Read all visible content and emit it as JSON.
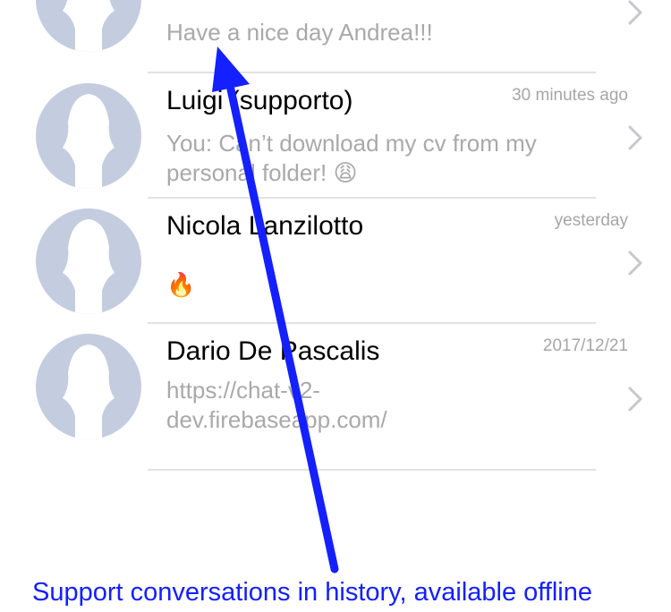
{
  "conversations": [
    {
      "name": "",
      "time": "",
      "preview": "Have a nice day Andrea!!!",
      "emoji": ""
    },
    {
      "name": "Luigi (supporto)",
      "time": "30 minutes ago",
      "preview": "You: Can’t download my cv from my personal folder!",
      "emoji": "😩"
    },
    {
      "name": "Nicola Lanzilotto",
      "time": "yesterday",
      "preview": "",
      "emoji": "🔥"
    },
    {
      "name": "Dario De Pascalis",
      "time": "2017/12/21",
      "preview": "https://chat-v2-dev.firebaseapp.com/",
      "emoji": ""
    }
  ],
  "annotation": {
    "caption": "Support conversations in history, available offline",
    "color": "#1420ff"
  },
  "icons": {
    "avatar": "person-silhouette-icon",
    "chevron": "chevron-right-icon"
  }
}
